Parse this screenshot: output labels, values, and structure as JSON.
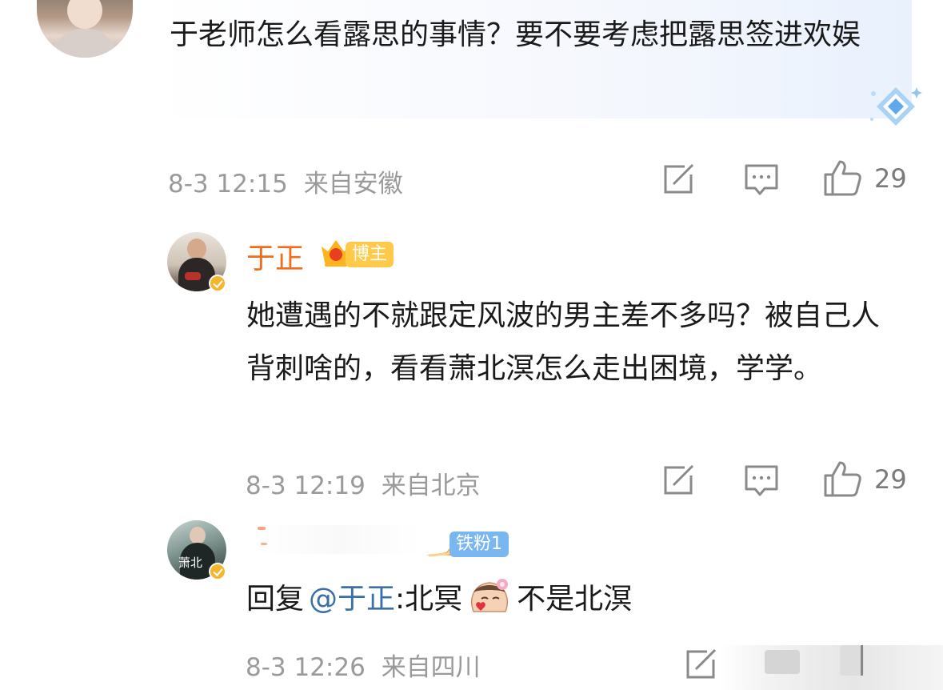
{
  "comments": [
    {
      "text": "于老师怎么看露思的事情？要不要考虑把露思签进欢娱",
      "time": "8-3 12:15",
      "location": "来自安徽",
      "likes": "29"
    },
    {
      "username": "于正",
      "badge": "博主",
      "text": "她遭遇的不就跟定风波的男主差不多吗？被自己人背刺啥的，看看萧北溟怎么走出困境，学学。",
      "time": "8-3 12:19",
      "location": "来自北京",
      "likes": "29"
    },
    {
      "badge": "铁粉1",
      "avatar_text": "萧北",
      "reply_prefix": "回复",
      "mention": "@于正",
      "text_a": ":北冥",
      "text_b": "不是北溟",
      "time": "8-3 12:26",
      "location": "来自四川"
    }
  ],
  "icons": [
    "edit-icon",
    "comment-icon",
    "like-icon"
  ],
  "colors": {
    "username": "#f26c1d",
    "mention": "#3a6fa8",
    "meta": "#9a9a9a"
  }
}
